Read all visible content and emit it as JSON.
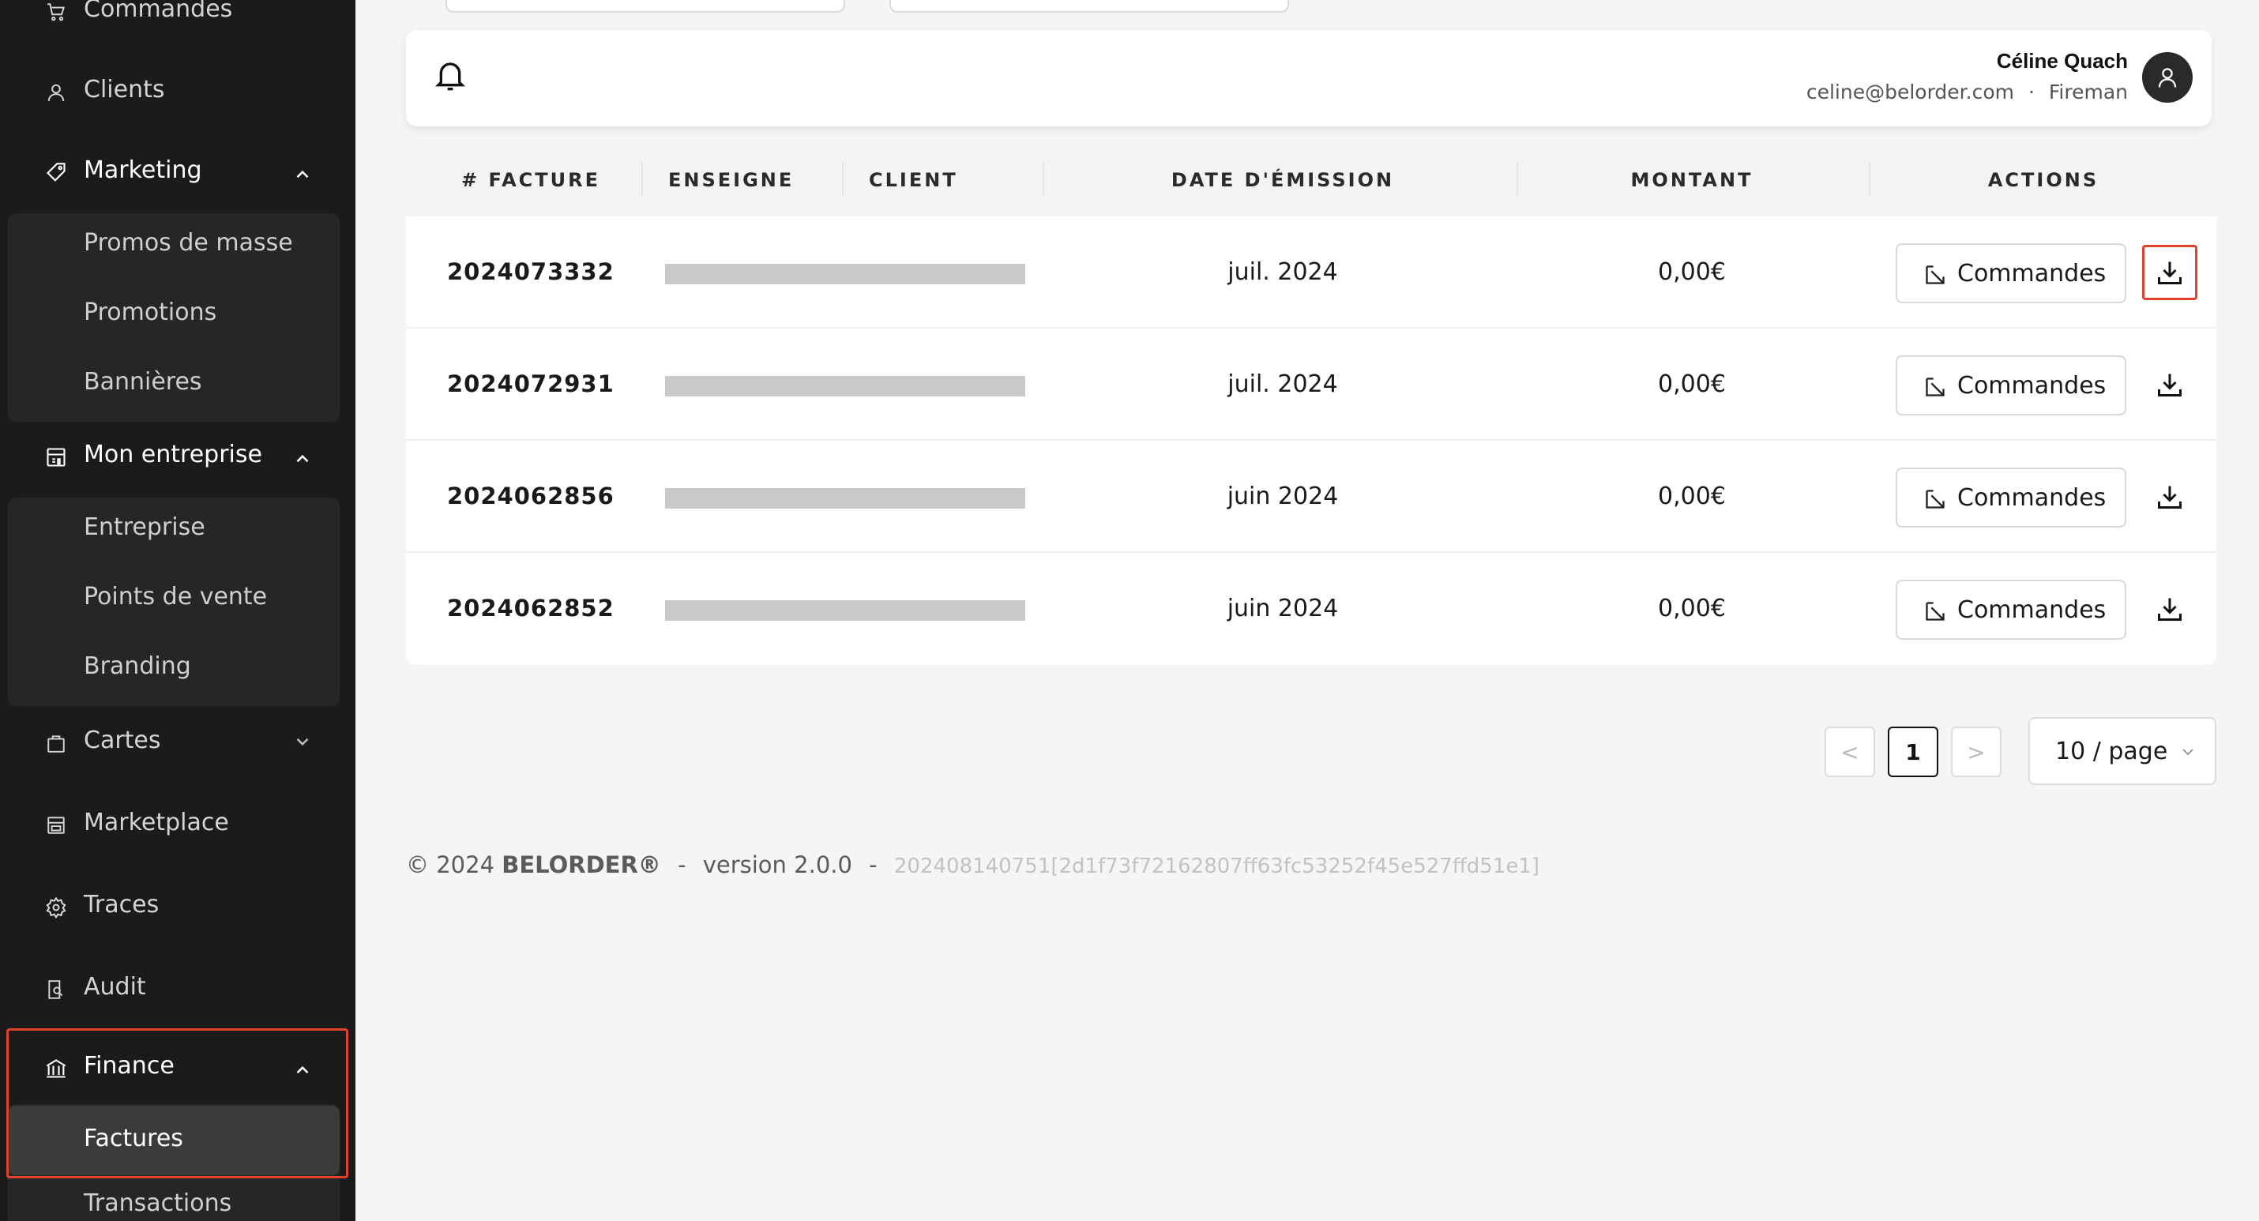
{
  "sidebar": {
    "items": [
      {
        "label": "Commandes"
      },
      {
        "label": "Clients"
      },
      {
        "label": "Marketing"
      },
      {
        "label": "Mon entreprise"
      },
      {
        "label": "Cartes"
      },
      {
        "label": "Marketplace"
      },
      {
        "label": "Traces"
      },
      {
        "label": "Audit"
      },
      {
        "label": "Finance"
      }
    ],
    "marketing_sub": [
      "Promos de masse",
      "Promotions",
      "Bannières"
    ],
    "entreprise_sub": [
      "Entreprise",
      "Points de vente",
      "Branding"
    ],
    "finance_sub": [
      "Factures",
      "Transactions"
    ]
  },
  "header": {
    "user_name": "Céline Quach",
    "user_email": "celine@belorder.com",
    "separator": "·",
    "user_role": "Fireman"
  },
  "table": {
    "columns": [
      "# FACTURE",
      "ENSEIGNE",
      "CLIENT",
      "DATE D'ÉMISSION",
      "MONTANT",
      "ACTIONS"
    ],
    "rows": [
      {
        "facture": "2024073332",
        "date": "juil. 2024",
        "montant": "0,00€",
        "action": "Commandes"
      },
      {
        "facture": "2024072931",
        "date": "juil. 2024",
        "montant": "0,00€",
        "action": "Commandes"
      },
      {
        "facture": "2024062856",
        "date": "juin 2024",
        "montant": "0,00€",
        "action": "Commandes"
      },
      {
        "facture": "2024062852",
        "date": "juin 2024",
        "montant": "0,00€",
        "action": "Commandes"
      }
    ]
  },
  "pagination": {
    "prev": "<",
    "current": "1",
    "next": ">",
    "page_size": "10 / page"
  },
  "footer": {
    "copyright": "© 2024",
    "brand": "BELORDER®",
    "dash": "-",
    "version": "version 2.0.0",
    "build": "202408140751[2d1f73f72162807ff63fc53252f45e527ffd51e1]"
  },
  "colors": {
    "sidebar_bg": "#1b1b1b",
    "highlight": "#e0432d",
    "page_bg": "#f5f5f5"
  },
  "icons": [
    "cart-icon",
    "user-icon",
    "tag-icon",
    "building-icon",
    "bag-icon",
    "store-icon",
    "gear-icon",
    "audit-icon",
    "bank-icon",
    "bell-icon",
    "avatar-icon",
    "external-link-icon",
    "download-icon"
  ]
}
